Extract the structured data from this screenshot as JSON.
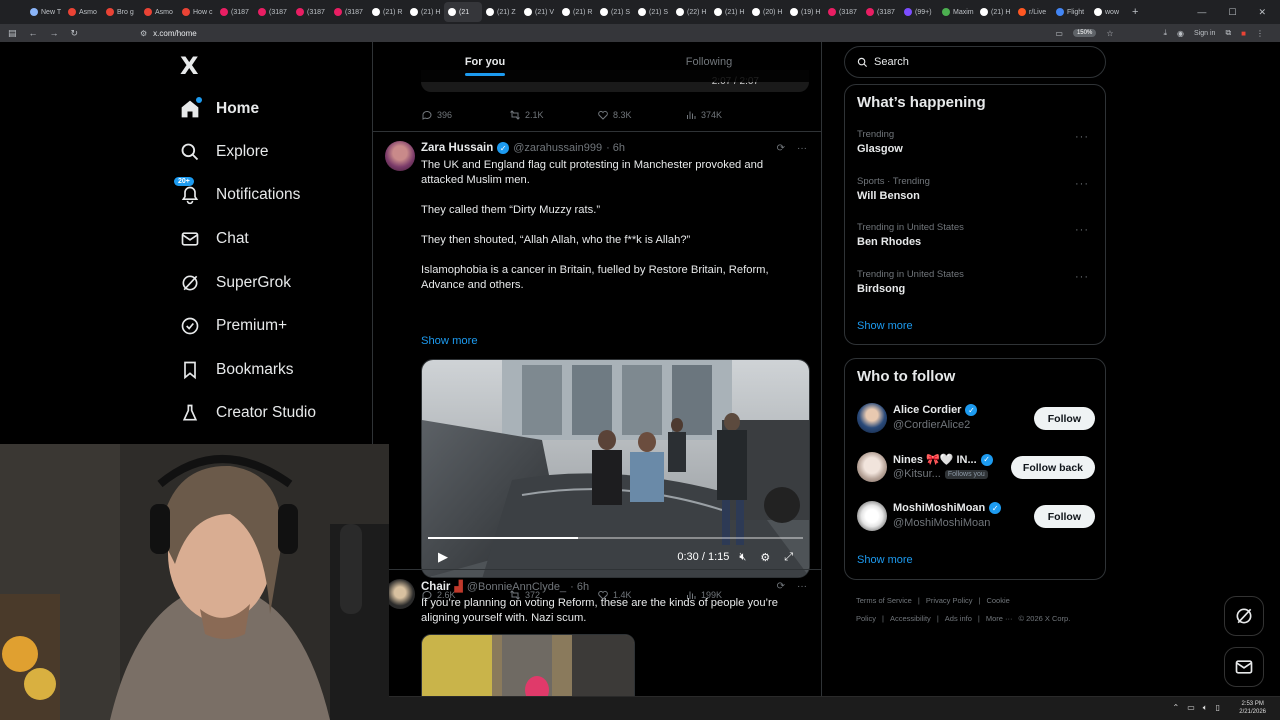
{
  "browser": {
    "tabs": [
      {
        "label": "New T",
        "color": "#8ab4f8"
      },
      {
        "label": "Asmo",
        "color": "#ea4335"
      },
      {
        "label": "Bro g",
        "color": "#ea4335"
      },
      {
        "label": "Asmo",
        "color": "#ea4335"
      },
      {
        "label": "How c",
        "color": "#ea4335"
      },
      {
        "label": "(3187",
        "color": "#e91e63"
      },
      {
        "label": "(3187",
        "color": "#e91e63"
      },
      {
        "label": "(3187",
        "color": "#e91e63"
      },
      {
        "label": "(3187",
        "color": "#e91e63"
      },
      {
        "label": "(21) R",
        "color": "#ffffff"
      },
      {
        "label": "(21) H",
        "color": "#ffffff"
      },
      {
        "label": "(21",
        "color": "#ffffff"
      },
      {
        "label": "(21) Z",
        "color": "#ffffff"
      },
      {
        "label": "(21) V",
        "color": "#ffffff"
      },
      {
        "label": "(21) R",
        "color": "#ffffff"
      },
      {
        "label": "(21) S",
        "color": "#ffffff"
      },
      {
        "label": "(21) S",
        "color": "#ffffff"
      },
      {
        "label": "(22) H",
        "color": "#ffffff"
      },
      {
        "label": "(21) H",
        "color": "#ffffff"
      },
      {
        "label": "(20) H",
        "color": "#ffffff"
      },
      {
        "label": "(19) H",
        "color": "#ffffff"
      },
      {
        "label": "(3187",
        "color": "#e91e63"
      },
      {
        "label": "(3187",
        "color": "#e91e63"
      },
      {
        "label": "(99+)",
        "color": "#7c4dff"
      },
      {
        "label": "Maxim",
        "color": "#4caf50"
      },
      {
        "label": "(21) H",
        "color": "#ffffff"
      },
      {
        "label": "r/Live",
        "color": "#ff5722"
      },
      {
        "label": "Flight",
        "color": "#4285f4"
      },
      {
        "label": "wow",
        "color": "#ffffff"
      }
    ],
    "url": "x.com/home",
    "zoom": "150%",
    "signin": "Sign in",
    "active_tab_index": 11
  },
  "nav": {
    "logo": "X",
    "items": [
      {
        "id": "home",
        "label": "Home",
        "icon": "home-icon"
      },
      {
        "id": "explore",
        "label": "Explore",
        "icon": "search-icon"
      },
      {
        "id": "notifications",
        "label": "Notifications",
        "icon": "bell-icon",
        "badge": "20+"
      },
      {
        "id": "chat",
        "label": "Chat",
        "icon": "mail-icon"
      },
      {
        "id": "supergrok",
        "label": "SuperGrok",
        "icon": "grok-icon"
      },
      {
        "id": "premium",
        "label": "Premium+",
        "icon": "verified-badge-icon"
      },
      {
        "id": "bookmarks",
        "label": "Bookmarks",
        "icon": "bookmark-icon"
      },
      {
        "id": "creator",
        "label": "Creator Studio",
        "icon": "flask-icon"
      }
    ]
  },
  "feed": {
    "tabs": [
      "For you",
      "Following"
    ],
    "prev_video_time": "2:07 / 2:07",
    "prev_actions": {
      "replies": "396",
      "reposts": "2.1K",
      "likes": "8.3K",
      "views": "374K"
    },
    "post1": {
      "name": "Zara Hussain",
      "handle": "@zarahussain999",
      "time": "· 6h",
      "lines": [
        "The UK and England flag cult protesting in Manchester provoked and attacked Muslim men.",
        "They called them “Dirty Muzzy rats.”",
        "They then shouted, “Allah Allah, who the f**k is Allah?”",
        "Islamophobia is a cancer in Britain, fuelled by Restore Britain, Reform, Advance and others."
      ],
      "show_more": "Show more",
      "video_time": "0:30 / 1:15",
      "video_progress": 0.4,
      "actions": {
        "replies": "2.6K",
        "reposts": "372",
        "likes": "1.4K",
        "views": "199K"
      }
    },
    "post2": {
      "name": "Chair",
      "handle": "@BonnieAnnClyde_",
      "time": "· 6h",
      "text": "If you’re planning on voting Reform, these are the kinds of people you’re aligning yourself with. Nazi scum."
    }
  },
  "sidebar": {
    "search_placeholder": "Search",
    "happening_title": "What’s happening",
    "trends": [
      {
        "category": "Trending",
        "name": "Glasgow"
      },
      {
        "category": "Sports · Trending",
        "name": "Will Benson"
      },
      {
        "category": "Trending in United States",
        "name": "Ben Rhodes"
      },
      {
        "category": "Trending in United States",
        "name": "Birdsong"
      }
    ],
    "show_more": "Show more",
    "wtf_title": "Who to follow",
    "who_to_follow": [
      {
        "name": "Alice Cordier",
        "handle": "@CordierAlice2",
        "button": "Follow",
        "follows_you": ""
      },
      {
        "name": "Nines 🎀🤍 IN...",
        "handle": "@Kitsur...",
        "button": "Follow back",
        "follows_you": "Follows you"
      },
      {
        "name": "MoshiMoshiMoan",
        "handle": "@MoshiMoshiMoan",
        "button": "Follow",
        "follows_you": ""
      }
    ],
    "wtf_show_more": "Show more",
    "footer": [
      "Terms of Service",
      "|",
      "Privacy Policy",
      "|",
      "Cookie Policy",
      "|",
      "Accessibility",
      "|",
      "Ads info",
      "|",
      "More ···",
      "© 2026 X Corp."
    ]
  },
  "taskbar": {
    "time": "2:53 PM",
    "date": "2/21/2026"
  }
}
